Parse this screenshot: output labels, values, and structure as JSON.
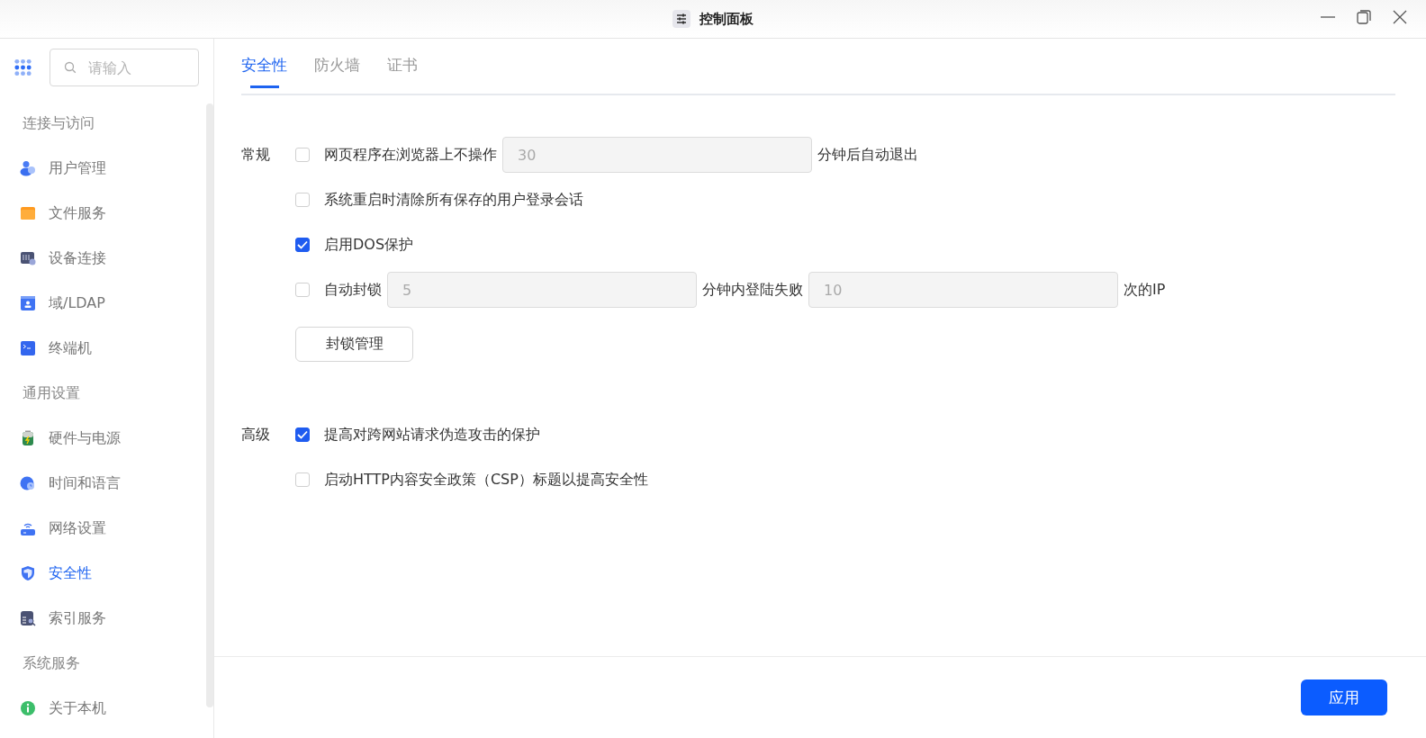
{
  "window": {
    "title": "控制面板"
  },
  "search": {
    "placeholder": "请输入"
  },
  "sidebar": {
    "items": [
      {
        "kind": "header",
        "label": "连接与访问"
      },
      {
        "kind": "item",
        "label": "用户管理",
        "selected": false
      },
      {
        "kind": "item",
        "label": "文件服务",
        "selected": false
      },
      {
        "kind": "item",
        "label": "设备连接",
        "selected": false
      },
      {
        "kind": "item",
        "label": "域/LDAP",
        "selected": false
      },
      {
        "kind": "item",
        "label": "终端机",
        "selected": false
      },
      {
        "kind": "header",
        "label": "通用设置"
      },
      {
        "kind": "item",
        "label": "硬件与电源",
        "selected": false
      },
      {
        "kind": "item",
        "label": "时间和语言",
        "selected": false
      },
      {
        "kind": "item",
        "label": "网络设置",
        "selected": false
      },
      {
        "kind": "item",
        "label": "安全性",
        "selected": true
      },
      {
        "kind": "item",
        "label": "索引服务",
        "selected": false
      },
      {
        "kind": "header",
        "label": "系统服务"
      },
      {
        "kind": "item",
        "label": "关于本机",
        "selected": false
      }
    ]
  },
  "tabs": [
    {
      "label": "安全性",
      "selected": true
    },
    {
      "label": "防火墙",
      "selected": false
    },
    {
      "label": "证书",
      "selected": false
    }
  ],
  "sections": [
    {
      "label": "常规",
      "rows": [
        {
          "kind": "option",
          "checked": false,
          "parts": [
            {
              "kind": "text",
              "text": "网页程序在浏览器上不操作"
            },
            {
              "kind": "field",
              "value": "30"
            },
            {
              "kind": "text",
              "text": "分钟后自动退出"
            }
          ]
        },
        {
          "kind": "option",
          "checked": false,
          "parts": [
            {
              "kind": "text",
              "text": "系统重启时清除所有保存的用户登录会话"
            }
          ]
        },
        {
          "kind": "option",
          "checked": true,
          "parts": [
            {
              "kind": "text",
              "text": "启用DOS保护"
            }
          ]
        },
        {
          "kind": "option",
          "checked": false,
          "parts": [
            {
              "kind": "text",
              "text": "自动封锁"
            },
            {
              "kind": "field",
              "value": "5"
            },
            {
              "kind": "text",
              "text": "分钟内登陆失败"
            },
            {
              "kind": "field",
              "value": "10"
            },
            {
              "kind": "text",
              "text": "次的IP"
            }
          ]
        },
        {
          "kind": "button",
          "label": "封锁管理"
        }
      ]
    },
    {
      "label": "高级",
      "rows": [
        {
          "kind": "option",
          "checked": true,
          "parts": [
            {
              "kind": "text",
              "text": "提高对跨网站请求伪造攻击的保护"
            }
          ]
        },
        {
          "kind": "option",
          "checked": false,
          "parts": [
            {
              "kind": "text",
              "text": "启动HTTP内容安全政策（CSP）标题以提高安全性"
            }
          ]
        }
      ]
    }
  ],
  "footer": {
    "apply_button": "应用"
  }
}
